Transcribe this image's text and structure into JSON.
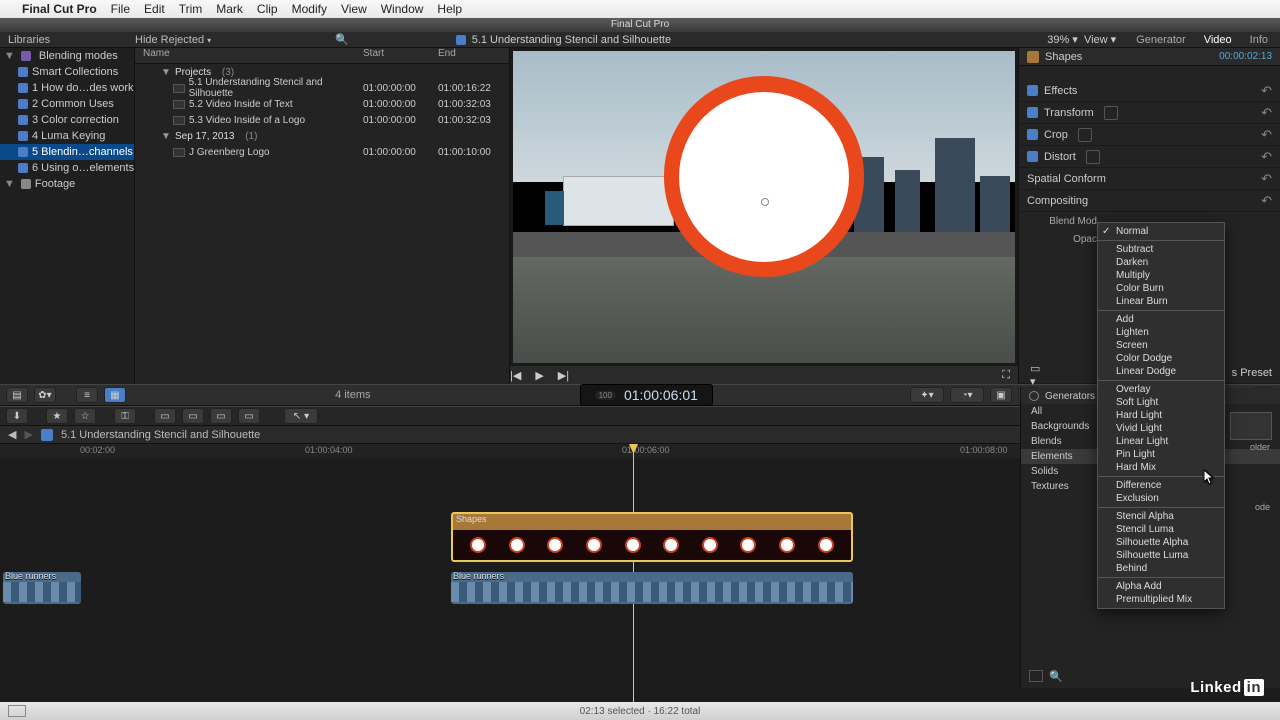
{
  "menubar": {
    "app": "Final Cut Pro",
    "items": [
      "File",
      "Edit",
      "Trim",
      "Mark",
      "Clip",
      "Modify",
      "View",
      "Window",
      "Help"
    ]
  },
  "window_title": "Final Cut Pro",
  "library_header": {
    "libraries": "Libraries",
    "hide": "Hide Rejected"
  },
  "sidebar": {
    "root": "Blending modes",
    "items": [
      {
        "label": "Smart Collections"
      },
      {
        "label": "1 How do…des work"
      },
      {
        "label": "2 Common Uses"
      },
      {
        "label": "3 Color correction"
      },
      {
        "label": "4 Luma Keying"
      },
      {
        "label": "5 Blendin…channels",
        "selected": true
      },
      {
        "label": "6 Using o…elements"
      }
    ],
    "footage": "Footage"
  },
  "browser": {
    "headers": {
      "name": "Name",
      "start": "Start",
      "end": "End"
    },
    "projects_label": "Projects",
    "projects_count": "(3)",
    "projects": [
      {
        "name": "5.1 Understanding Stencil and Silhouette",
        "start": "01:00:00:00",
        "end": "01:00:16:22"
      },
      {
        "name": "5.2 Video Inside of Text",
        "start": "01:00:00:00",
        "end": "01:00:32:03"
      },
      {
        "name": "5.3 Video Inside of a Logo",
        "start": "01:00:00:00",
        "end": "01:00:32:03"
      }
    ],
    "date_label": "Sep 17, 2013",
    "date_count": "(1)",
    "clips": [
      {
        "name": "J Greenberg Logo",
        "start": "01:00:00:00",
        "end": "01:00:10:00"
      }
    ],
    "items_count": "4 items"
  },
  "viewer": {
    "title": "5.1 Understanding Stencil and Silhouette",
    "zoom": "39%",
    "view": "View"
  },
  "inspector": {
    "tabs": {
      "generator": "Generator",
      "video": "Video",
      "info": "Info"
    },
    "title": "Shapes",
    "timecode": "00:00:02:13",
    "sections": [
      "Effects",
      "Transform",
      "Crop",
      "Distort",
      "Spatial Conform",
      "Compositing"
    ],
    "blend_label": "Blend Mod",
    "opacity_label": "Opac",
    "save_preset": "s Preset"
  },
  "mid": {
    "timecode": "01:00:06:01",
    "tc_badge": "100"
  },
  "timeline": {
    "title": "5.1 Understanding Stencil and Silhouette",
    "ruler": [
      "00:02:00",
      "01:00:04:00",
      "01:00:06:00",
      "01:00:08:00"
    ],
    "shapes_label": "Shapes",
    "blue_label": "Blue runners"
  },
  "generators": {
    "title": "Generators",
    "cats": [
      "All",
      "Backgrounds",
      "Blends",
      "Elements",
      "Solids",
      "Textures"
    ],
    "thumb": "older",
    "mode": "ode"
  },
  "blend_modes": {
    "selected": "Normal",
    "groups": [
      [
        "Normal"
      ],
      [
        "Subtract",
        "Darken",
        "Multiply",
        "Color Burn",
        "Linear Burn"
      ],
      [
        "Add",
        "Lighten",
        "Screen",
        "Color Dodge",
        "Linear Dodge"
      ],
      [
        "Overlay",
        "Soft Light",
        "Hard Light",
        "Vivid Light",
        "Linear Light",
        "Pin Light",
        "Hard Mix"
      ],
      [
        "Difference",
        "Exclusion"
      ],
      [
        "Stencil Alpha",
        "Stencil Luma",
        "Silhouette Alpha",
        "Silhouette Luma",
        "Behind"
      ],
      [
        "Alpha Add",
        "Premultiplied Mix"
      ]
    ]
  },
  "status": "02:13 selected · 16:22 total",
  "watermark": "Linked"
}
